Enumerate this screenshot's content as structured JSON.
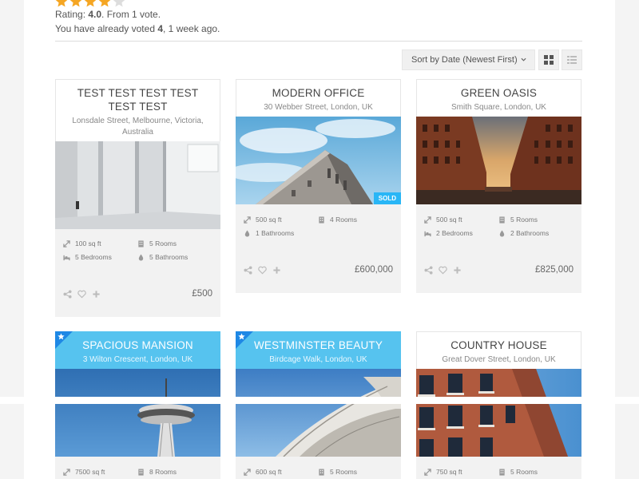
{
  "rating": {
    "stars_filled": 4,
    "stars_total": 5,
    "label_prefix": "Rating: ",
    "value": "4.0",
    "label_suffix": ". From 1 vote.",
    "voted_prefix": "You have already voted ",
    "voted_value": "4",
    "voted_suffix": ", 1 week ago."
  },
  "toolbar": {
    "sort_label": "Sort by Date (Newest First)",
    "grid_icon": "grid-view-icon",
    "list_icon": "list-view-icon"
  },
  "colors": {
    "star": "#f5a623",
    "featured": "#56c3ef",
    "sold_badge": "#29b6f6"
  },
  "listings": [
    {
      "title": "TEST TEST TEST TEST TEST TEST",
      "address": "Lonsdale Street, Melbourne, Victoria, Australia",
      "featured": false,
      "badge": "",
      "features": [
        {
          "icon": "area-icon",
          "text": "100 sq ft"
        },
        {
          "icon": "rooms-icon",
          "text": "5 Rooms"
        },
        {
          "icon": "bed-icon",
          "text": "5 Bedrooms"
        },
        {
          "icon": "bath-icon",
          "text": "5 Bathrooms"
        }
      ],
      "price": "£500"
    },
    {
      "title": "MODERN OFFICE",
      "address": "30 Webber Street, London, UK",
      "featured": false,
      "badge": "SOLD",
      "features": [
        {
          "icon": "area-icon",
          "text": "500 sq ft"
        },
        {
          "icon": "rooms-icon",
          "text": "4 Rooms"
        },
        {
          "icon": "bath-icon",
          "text": "1 Bathrooms"
        }
      ],
      "price": "£600,000"
    },
    {
      "title": "GREEN OASIS",
      "address": "Smith Square, London, UK",
      "featured": false,
      "badge": "",
      "features": [
        {
          "icon": "area-icon",
          "text": "500 sq ft"
        },
        {
          "icon": "rooms-icon",
          "text": "5 Rooms"
        },
        {
          "icon": "bed-icon",
          "text": "2 Bedrooms"
        },
        {
          "icon": "bath-icon",
          "text": "2 Bathrooms"
        }
      ],
      "price": "£825,000"
    },
    {
      "title": "SPACIOUS MANSION",
      "address": "3 Wilton Crescent, London, UK",
      "featured": true,
      "badge": "",
      "features": [
        {
          "icon": "area-icon",
          "text": "7500 sq ft"
        },
        {
          "icon": "rooms-icon",
          "text": "8 Rooms"
        }
      ],
      "price": ""
    },
    {
      "title": "WESTMINSTER BEAUTY",
      "address": "Birdcage Walk, London, UK",
      "featured": true,
      "badge": "",
      "features": [
        {
          "icon": "area-icon",
          "text": "600 sq ft"
        },
        {
          "icon": "rooms-icon",
          "text": "5 Rooms"
        }
      ],
      "price": ""
    },
    {
      "title": "COUNTRY HOUSE",
      "address": "Great Dover Street, London, UK",
      "featured": false,
      "badge": "",
      "features": [
        {
          "icon": "area-icon",
          "text": "750 sq ft"
        },
        {
          "icon": "rooms-icon",
          "text": "5 Rooms"
        }
      ],
      "price": ""
    }
  ]
}
